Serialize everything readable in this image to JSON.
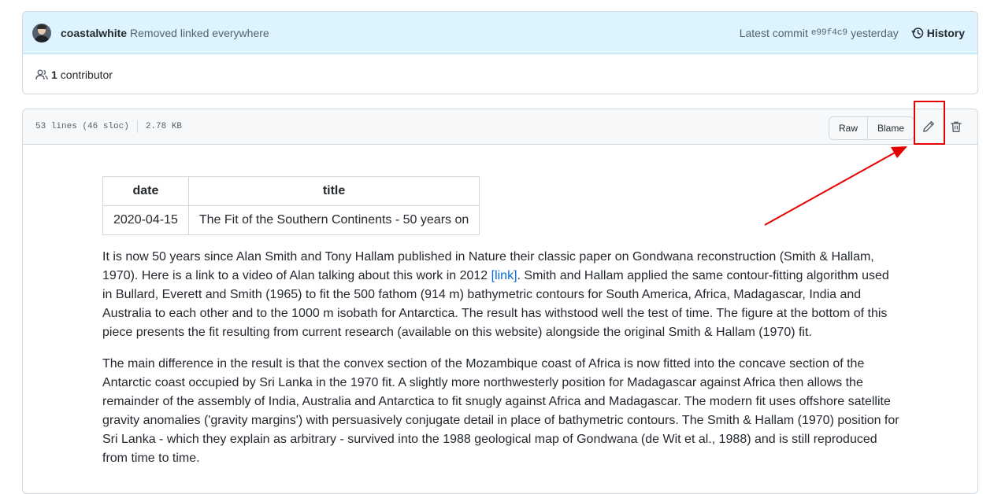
{
  "commit": {
    "author": "coastalwhite",
    "message": "Removed linked everywhere",
    "latest_label": "Latest commit",
    "sha": "e99f4c9",
    "time": "yesterday",
    "history_label": "History"
  },
  "contributors": {
    "count": "1",
    "label": "contributor"
  },
  "file": {
    "lines": "53 lines (46 sloc)",
    "size": "2.78 KB",
    "raw_label": "Raw",
    "blame_label": "Blame"
  },
  "table": {
    "headers": [
      "date",
      "title"
    ],
    "rows": [
      [
        "2020-04-15",
        "The Fit of the Southern Continents - 50 years on"
      ]
    ]
  },
  "paragraphs": {
    "p1_before_link": "It is now 50 years since Alan Smith and Tony Hallam published in Nature their classic paper on Gondwana reconstruction (Smith & Hallam, 1970). Here is a link to a video of Alan talking about this work in 2012 ",
    "p1_link": "[link]",
    "p1_after_link": ". Smith and Hallam applied the same contour-fitting algorithm used in Bullard, Everett and Smith (1965) to fit the 500 fathom (914 m) bathymetric contours for South America, Africa, Madagascar, India and Australia to each other and to the 1000 m isobath for Antarctica. The result has withstood well the test of time. The figure at the bottom of this piece presents the fit resulting from current research (available on this website) alongside the original Smith & Hallam (1970) fit.",
    "p2": "The main difference in the result is that the convex section of the Mozambique coast of Africa is now fitted into the concave section of the Antarctic coast occupied by Sri Lanka in the 1970 fit. A slightly more northwesterly position for Madagascar against Africa then allows the remainder of the assembly of India, Australia and Antarctica to fit snugly against Africa and Madagascar. The modern fit uses offshore satellite gravity anomalies ('gravity margins') with persuasively conjugate detail in place of bathymetric contours. The Smith & Hallam (1970) position for Sri Lanka - which they explain as arbitrary - survived into the 1988 geological map of Gondwana (de Wit et al., 1988) and is still reproduced from time to time."
  },
  "icons": {
    "history": "history-icon",
    "people": "people-icon",
    "edit": "pencil-icon",
    "delete": "trash-icon"
  },
  "colors": {
    "commit_bar_bg": "#ddf4ff",
    "link": "#0969da",
    "annotation": "#e60000"
  }
}
